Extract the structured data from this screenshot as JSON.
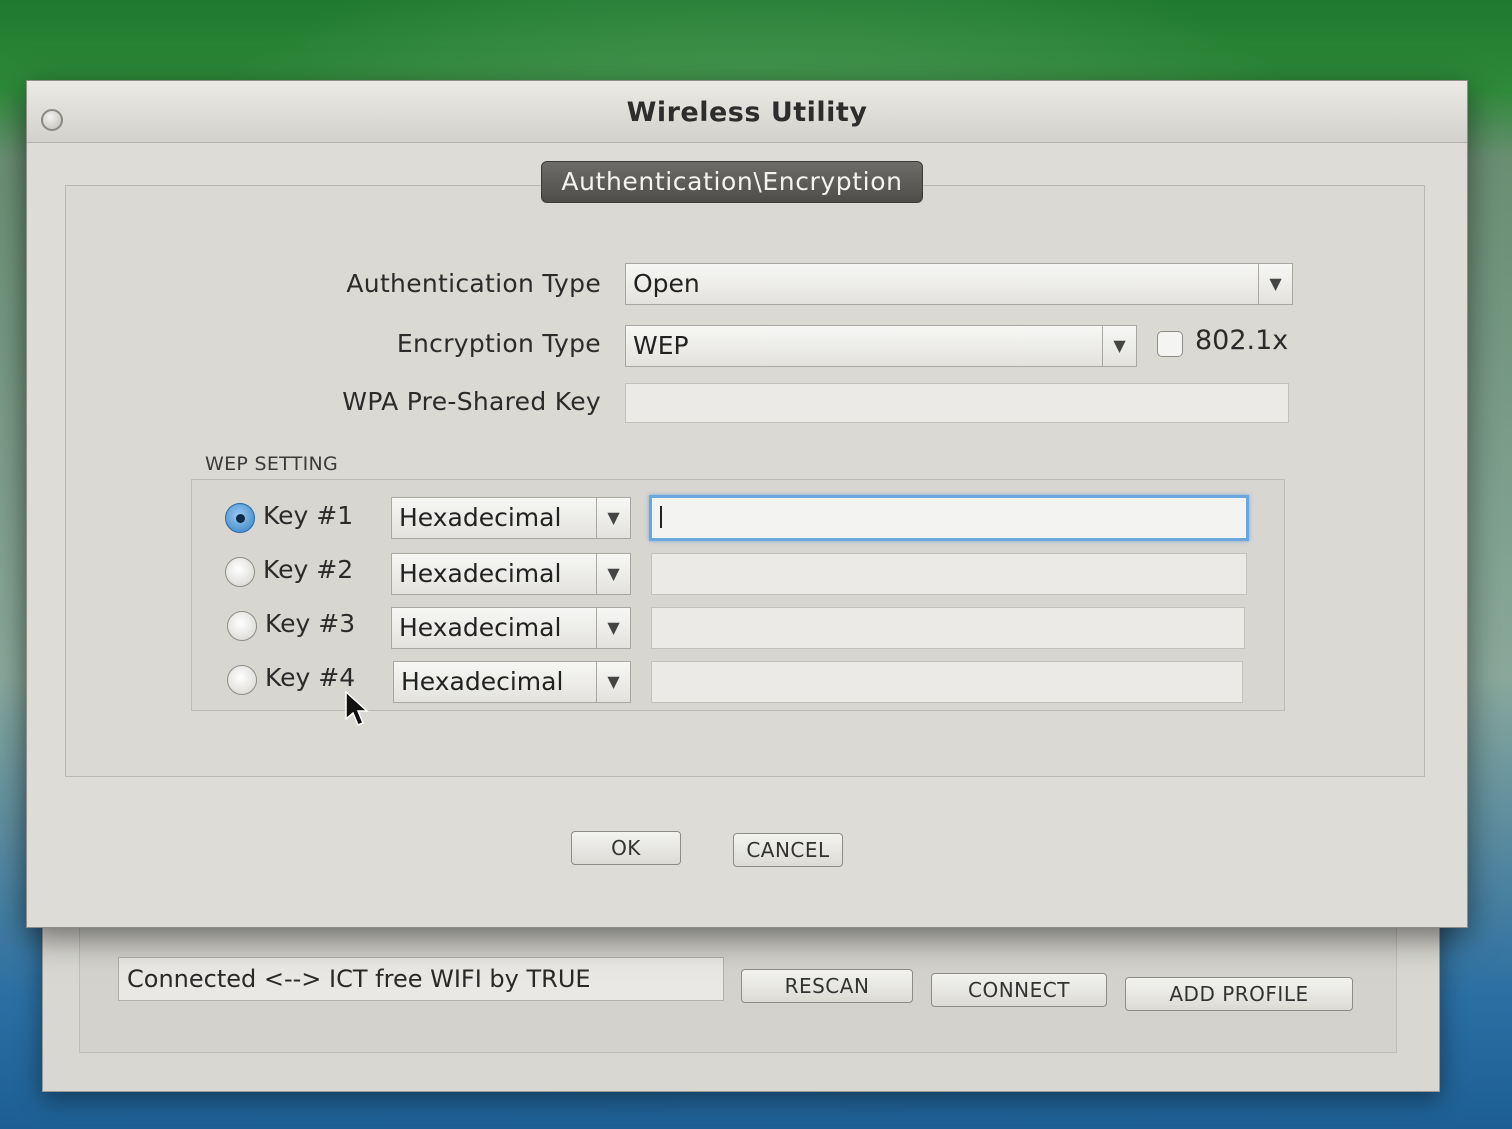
{
  "main_window": {
    "status_text": "Connected <--> ICT free WIFI by TRUE",
    "buttons": {
      "rescan": "RESCAN",
      "connect": "CONNECT",
      "add_profile": "ADD PROFILE"
    }
  },
  "dialog": {
    "title": "Wireless Utility",
    "section_tab": "Authentication\\Encryption",
    "auth_type": {
      "label": "Authentication Type",
      "value": "Open"
    },
    "encryption_type": {
      "label": "Encryption Type",
      "value": "WEP"
    },
    "dot1x": {
      "label": "802.1x",
      "checked": false
    },
    "wpa_psk": {
      "label": "WPA Pre-Shared Key",
      "value": ""
    },
    "wep_setting": {
      "title": "WEP SETTING",
      "keys": [
        {
          "label": "Key #1",
          "format": "Hexadecimal",
          "value": "",
          "selected": true
        },
        {
          "label": "Key #2",
          "format": "Hexadecimal",
          "value": "",
          "selected": false
        },
        {
          "label": "Key #3",
          "format": "Hexadecimal",
          "value": "",
          "selected": false
        },
        {
          "label": "Key #4",
          "format": "Hexadecimal",
          "value": "",
          "selected": false
        }
      ]
    },
    "buttons": {
      "ok": "OK",
      "cancel": "CANCEL"
    }
  },
  "icons": {
    "close": "close-icon",
    "dropdown": "chevron-down-icon",
    "pointer": "cursor-icon"
  },
  "colors": {
    "focus_ring": "#6aa7dc",
    "radio_selected": "#2f7fc4",
    "tab_background": "#5a5955"
  }
}
